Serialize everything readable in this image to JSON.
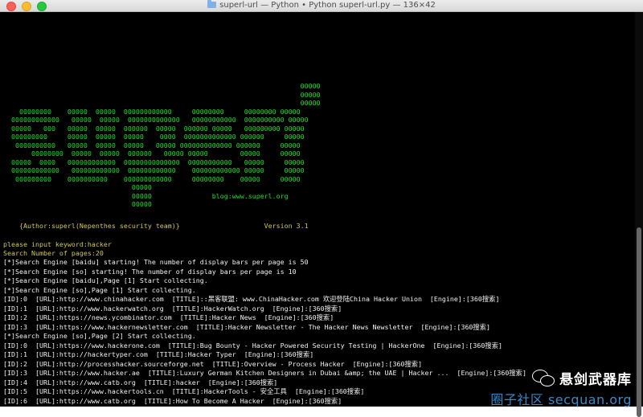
{
  "window": {
    "title": "superl-url — Python • Python superl-url.py — 136×42"
  },
  "banner": {
    "art": [
      "                                                                          00000",
      "                                                                          00000",
      "                                                                          00000",
      "    00000000    00000  00000  000000000000     00000000     00000000 00000",
      "  000000000000   00000  00000  0000000000000   00000000000  0000000000 00000",
      "  00000   000   00000  00000  000000  00000  000000 00000   000000000 00000",
      "  000000000     00000  00000  00000    0000  0000000000000 000000     00000",
      "   0000000000   00000  00000  00000   00000 0000000000000 000000     00000",
      "       00000000  00000  00000  000000   00000 00000        00000     00000",
      "  00000  0000   000000000000  00000000000000  00000000000   00000     00000",
      "  000000000000   000000000000  000000000000    000000000000 00000     00000",
      "   000000000    0000000000    000000000000     00000000    00000     00000",
      "                                00000",
      "                                00000               blog:www.superl.org",
      "                                00000"
    ],
    "author": "    {Author:superl(Nepenthes security team)}                     Version 3.1"
  },
  "prompt": {
    "lines": [
      "please input keyword:hacker",
      "Search Number of pages:20"
    ]
  },
  "output": {
    "lines": [
      "[*]Search Engine [baidu] starting! The number of display bars per page is 50",
      "[*]Search Engine [so] starting! The number of display bars per page is 10",
      "[*]Search Engine [baidu],Page [1] Start collecting.",
      "[*]Search Engine [so],Page [1] Start collecting.",
      "[ID]:0  [URL]:http://www.chinahacker.com  [TITLE]::黑客联盟: www.ChinaHacker.com 欢迎登陆China Hacker Union  [Engine]:[360搜索]",
      "[ID]:1  [URL]:http://www.hackerwatch.org  [TITLE]:HackerWatch.org  [Engine]:[360搜索]",
      "[ID]:2  [URL]:https://news.ycombinator.com  [TITLE]:Hacker News  [Engine]:[360搜索]",
      "[ID]:3  [URL]:https://www.hackernewsletter.com  [TITLE]:Hacker Newsletter - The Hacker News Newsletter  [Engine]:[360搜索]",
      "[*]Search Engine [so],Page [2] Start collecting.",
      "[ID]:0  [URL]:https://www.hackerone.com  [TITLE]:Bug Bounty - Hacker Powered Security Testing | HackerOne  [Engine]:[360搜索]",
      "[ID]:1  [URL]:http://hackertyper.com  [TITLE]:Hacker Typer  [Engine]:[360搜索]",
      "[ID]:2  [URL]:http://processhacker.sourceforge.net  [TITLE]:Overview - Process Hacker  [Engine]:[360搜索]",
      "[ID]:3  [URL]:http://www.hacker.ae  [TITLE]:Luxury German Kitchen Designers in Dubai &amp; the UAE | Hacker ...  [Engine]:[360搜索]",
      "[ID]:4  [URL]:http://www.catb.org  [TITLE]:hacker  [Engine]:[360搜索]",
      "[ID]:5  [URL]:https://www.hackertools.cn  [TITLE]:HackerTools - 安全工具  [Engine]:[360搜索]",
      "[ID]:6  [URL]:http://www.catb.org  [TITLE]:How To Become A Hacker  [Engine]:[360搜索]"
    ]
  },
  "watermark": {
    "name": "悬剑武器库",
    "site": "圈子社区 secquan.org"
  },
  "colors": {
    "banner": "#1edc2d",
    "prompt": "#d0c85a",
    "output": "#f2f2f2",
    "background": "#000000"
  }
}
